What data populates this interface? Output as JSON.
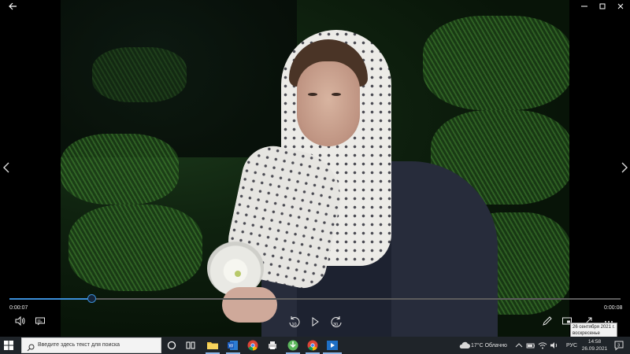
{
  "window": {
    "minimize_icon": "minimize-icon",
    "maximize_icon": "maximize-icon",
    "close_icon": "close-icon",
    "back_icon": "back-arrow-icon"
  },
  "viewer": {
    "prev_icon": "chevron-left-icon",
    "next_icon": "chevron-right-icon",
    "photo_alt_icon": "photo-image"
  },
  "player": {
    "elapsed": "0:00:07",
    "duration": "0:00:08",
    "progress": 0.135,
    "skip_back_label": "10",
    "skip_forward_label": "30",
    "controls": [
      "volume-icon",
      "subtitles-icon",
      "skip-back-icon",
      "play-icon",
      "skip-forward-icon",
      "edit-icon",
      "mini-view-icon",
      "fullscreen-icon",
      "more-icon"
    ]
  },
  "tooltip": {
    "line1": "26 сентября 2021 г.",
    "line2": "воскресенье"
  },
  "taskbar": {
    "search_placeholder": "Введите здесь текст для поиска",
    "weather": "17°C  Облачно",
    "language": "РУС",
    "time": "14:58",
    "date": "26.09.2021",
    "notification_count": "3",
    "apps": [
      "task-view-icon",
      "file-explorer-icon",
      "word-icon",
      "chrome-icon",
      "printer-app-icon",
      "torrent-icon",
      "chrome-icon",
      "media-player-icon"
    ],
    "accent": "#3b8fd9"
  }
}
